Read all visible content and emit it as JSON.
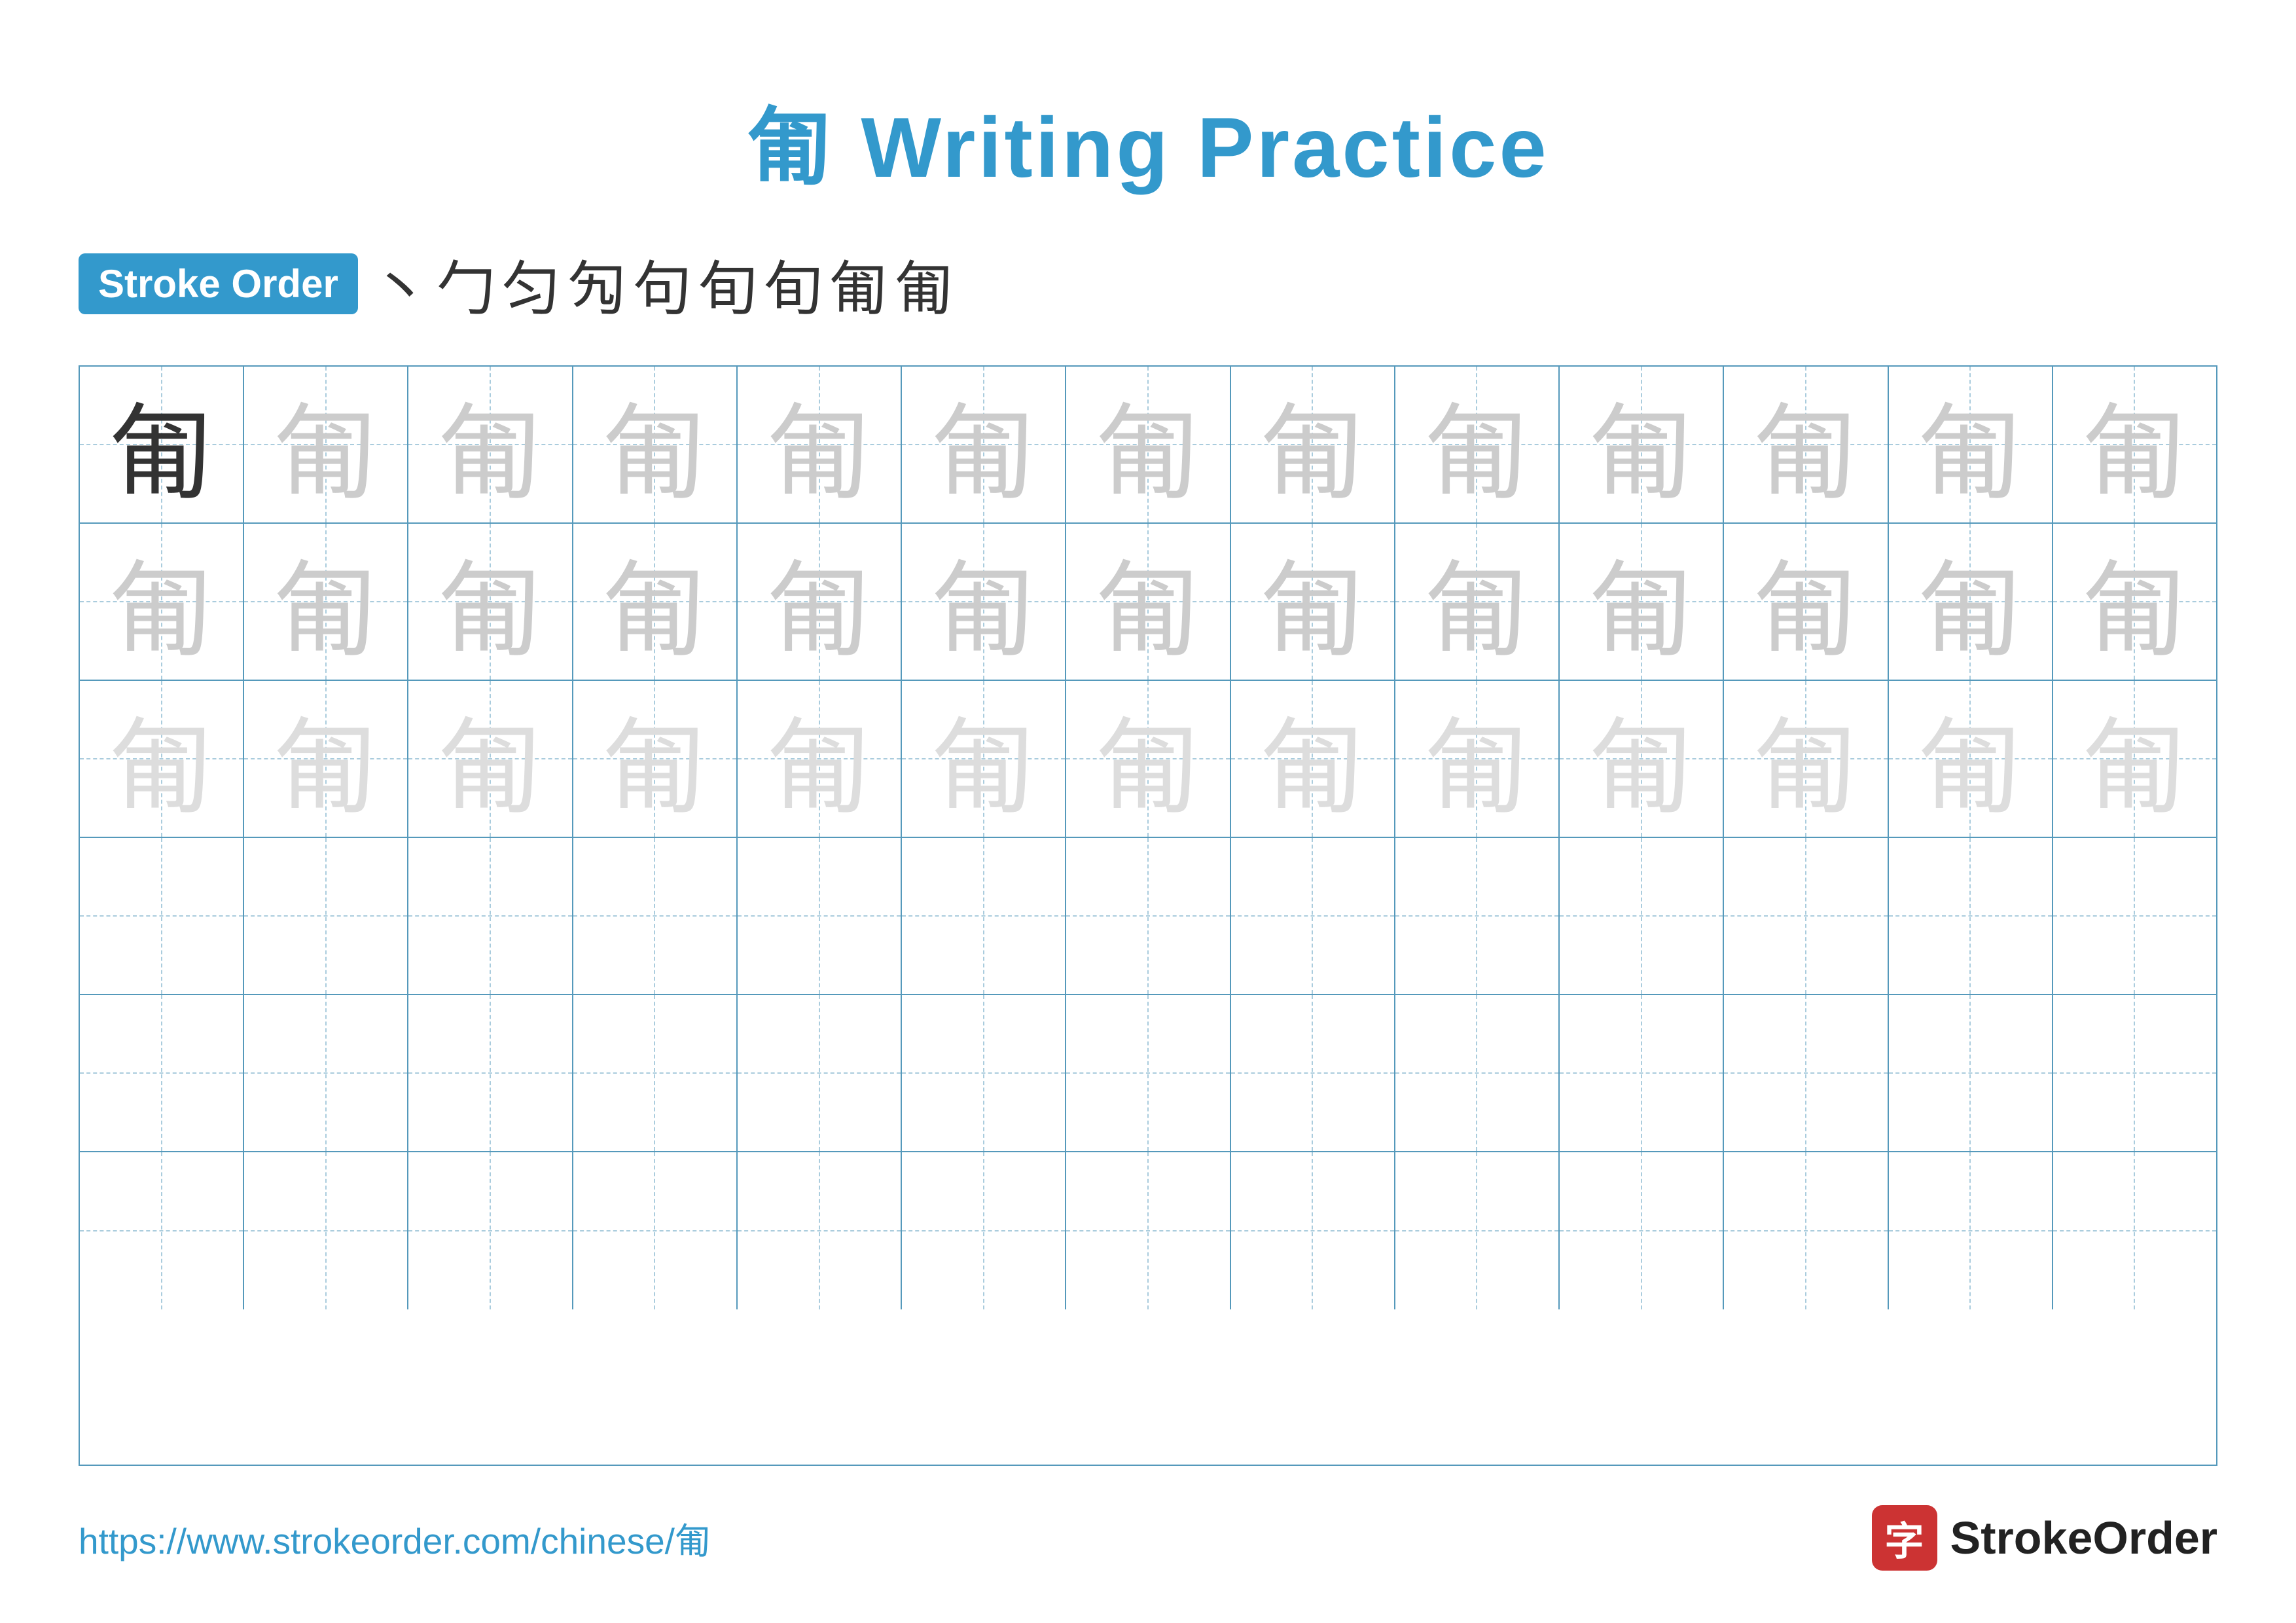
{
  "title": "匍 Writing Practice",
  "stroke_order_badge": "Stroke Order",
  "stroke_sequence": [
    "丶",
    "勹",
    "匀",
    "勼",
    "句",
    "旬",
    "旬",
    "匍",
    "匍"
  ],
  "main_char": "匍",
  "url": "https://www.strokeorder.com/chinese/匍",
  "logo_text": "StrokeOrder",
  "logo_icon": "字",
  "grid": {
    "rows": 6,
    "cols": 13,
    "row_data": [
      [
        "dark",
        "medium",
        "medium",
        "medium",
        "medium",
        "medium",
        "medium",
        "medium",
        "medium",
        "medium",
        "medium",
        "medium",
        "medium"
      ],
      [
        "medium",
        "medium",
        "medium",
        "medium",
        "medium",
        "medium",
        "medium",
        "medium",
        "medium",
        "medium",
        "medium",
        "medium",
        "medium"
      ],
      [
        "light",
        "light",
        "light",
        "light",
        "light",
        "light",
        "light",
        "light",
        "light",
        "light",
        "light",
        "light",
        "light"
      ],
      [
        "empty",
        "empty",
        "empty",
        "empty",
        "empty",
        "empty",
        "empty",
        "empty",
        "empty",
        "empty",
        "empty",
        "empty",
        "empty"
      ],
      [
        "empty",
        "empty",
        "empty",
        "empty",
        "empty",
        "empty",
        "empty",
        "empty",
        "empty",
        "empty",
        "empty",
        "empty",
        "empty"
      ],
      [
        "empty",
        "empty",
        "empty",
        "empty",
        "empty",
        "empty",
        "empty",
        "empty",
        "empty",
        "empty",
        "empty",
        "empty",
        "empty"
      ]
    ]
  }
}
